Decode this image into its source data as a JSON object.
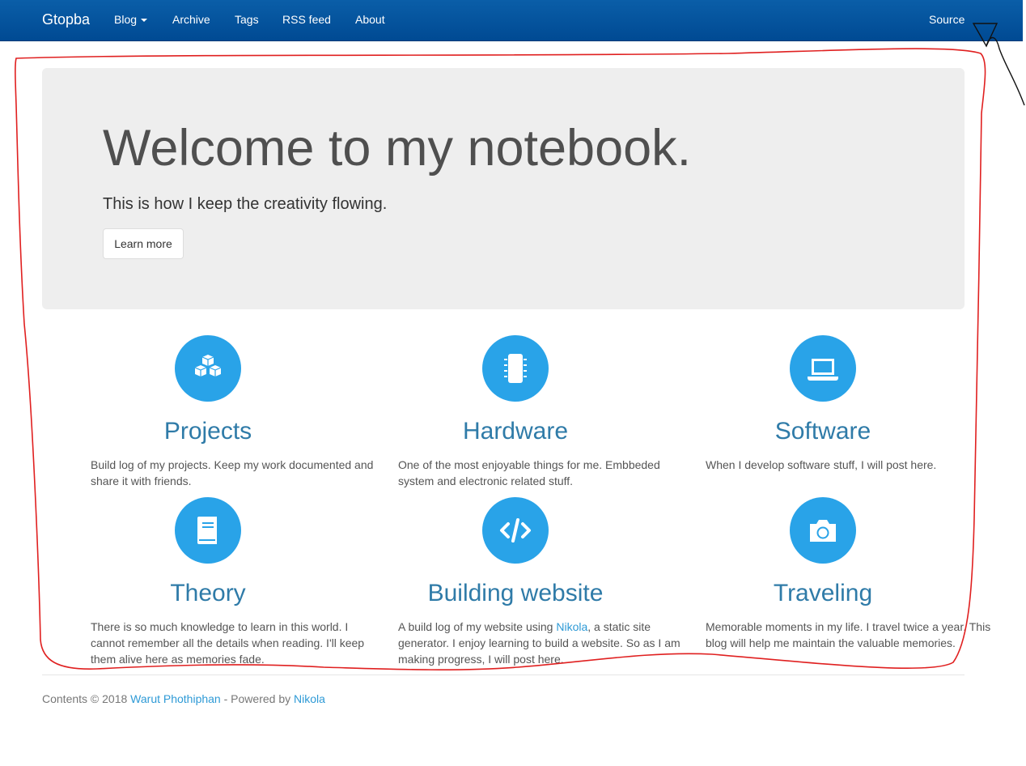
{
  "navbar": {
    "brand": "Gtopba",
    "items": [
      {
        "label": "Blog"
      },
      {
        "label": "Archive"
      },
      {
        "label": "Tags"
      },
      {
        "label": "RSS feed"
      },
      {
        "label": "About"
      }
    ],
    "source_label": "Source"
  },
  "jumbotron": {
    "title": "Welcome to my notebook.",
    "lead": "This is how I keep the creativity flowing.",
    "button_label": "Learn more"
  },
  "features": [
    {
      "title": "Projects",
      "icon": "cubes-icon",
      "text": "Build log of my projects. Keep my work documented and share it with friends."
    },
    {
      "title": "Hardware",
      "icon": "microchip-icon",
      "text": "One of the most enjoyable things for me. Embbeded system and electronic related stuff."
    },
    {
      "title": "Software",
      "icon": "laptop-icon",
      "text": "When I develop software stuff, I will post here."
    },
    {
      "title": "Theory",
      "icon": "book-icon",
      "text": "There is so much knowledge to learn in this world. I cannot remember all the details when reading. I'll keep them alive here as memories fade."
    },
    {
      "title": "Building website",
      "icon": "code-icon",
      "text_before": "A build log of my website using ",
      "link": "Nikola",
      "text_after": ", a static site generator. I enjoy learning to build a website. So as I am making progress, I will post here."
    },
    {
      "title": "Traveling",
      "icon": "camera-icon",
      "text": "Memorable moments in my life. I travel twice a year. This blog will help me maintain the valuable memories."
    }
  ],
  "footer": {
    "prefix": "Contents © 2018 ",
    "author": "Warut Phothiphan",
    "middle": " - Powered by ",
    "engine": "Nikola"
  },
  "colors": {
    "navbar": "#004a93",
    "accent": "#29a3e8",
    "heading": "#2f7ba8",
    "annotation": "#e02020"
  }
}
